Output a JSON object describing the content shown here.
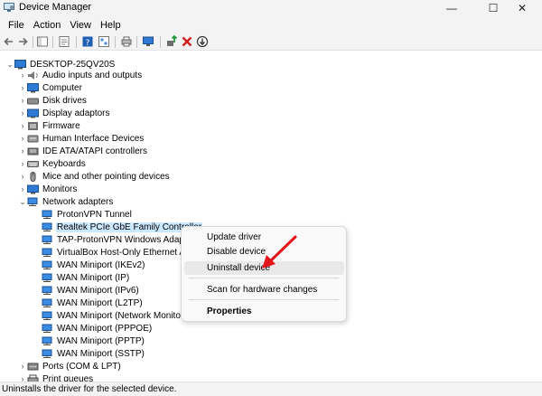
{
  "window": {
    "title": "Device Manager",
    "controls": {
      "minimize": "—",
      "maximize": "☐",
      "close": "✕"
    }
  },
  "menu": [
    "File",
    "Action",
    "View",
    "Help"
  ],
  "toolbar": {
    "icons": [
      "back-icon",
      "forward-icon",
      "show-hide-icon",
      "properties-icon",
      "help-icon",
      "view-icon",
      "print-icon",
      "monitor-icon",
      "update-driver-icon",
      "uninstall-icon",
      "download-icon"
    ]
  },
  "tree": {
    "root": "DESKTOP-25QV20S",
    "categories": [
      "Audio inputs and outputs",
      "Computer",
      "Disk drives",
      "Display adaptors",
      "Firmware",
      "Human Interface Devices",
      "IDE ATA/ATAPI controllers",
      "Keyboards",
      "Mice and other pointing devices",
      "Monitors",
      "Network adapters"
    ],
    "network_adapters": [
      "ProtonVPN Tunnel",
      "Realtek PCIe GbE Family Controller",
      "TAP-ProtonVPN Windows Adapte",
      "VirtualBox Host-Only Ethernet Ad",
      "WAN Miniport (IKEv2)",
      "WAN Miniport (IP)",
      "WAN Miniport (IPv6)",
      "WAN Miniport (L2TP)",
      "WAN Miniport (Network Monitor)",
      "WAN Miniport (PPPOE)",
      "WAN Miniport (PPTP)",
      "WAN Miniport (SSTP)"
    ],
    "after": [
      "Ports (COM & LPT)",
      "Print queues"
    ],
    "selected": "Realtek PCIe GbE Family Controller"
  },
  "context_menu": {
    "items": [
      "Update driver",
      "Disable device",
      "Uninstall device",
      "Scan for hardware changes",
      "Properties"
    ],
    "highlighted": "Uninstall device"
  },
  "annotation": {
    "arrow_color": "#e4141b"
  },
  "status": "Uninstalls the driver for the selected device."
}
